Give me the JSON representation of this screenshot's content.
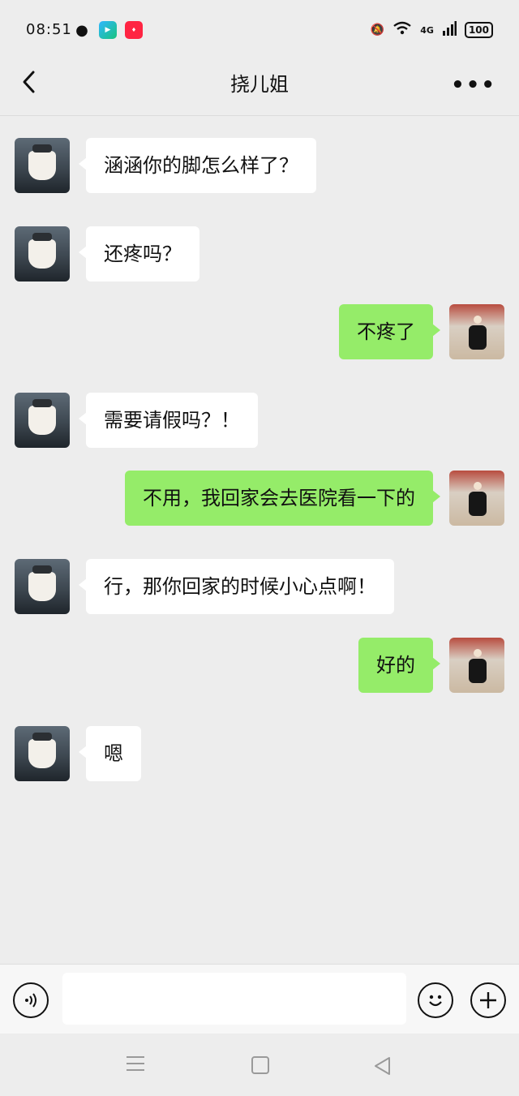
{
  "status_bar": {
    "time": "08:51",
    "network": "4G",
    "battery": "100",
    "icons": [
      "wechat-icon",
      "video-app-icon",
      "xiaohongshu-icon",
      "mute-bell-icon",
      "wifi-icon",
      "signal-icon",
      "battery-icon"
    ]
  },
  "header": {
    "title": "挠儿姐",
    "back_icon": "chevron-left-icon",
    "more_label": "•••"
  },
  "messages": [
    {
      "side": "left",
      "text": "涵涵你的脚怎么样了？"
    },
    {
      "side": "left",
      "text": "还疼吗？"
    },
    {
      "side": "right",
      "text": "不疼了"
    },
    {
      "side": "left",
      "text": "需要请假吗？！"
    },
    {
      "side": "right",
      "text": "不用，我回家会去医院看一下的"
    },
    {
      "side": "left",
      "text": "行，那你回家的时候小心点啊！"
    },
    {
      "side": "right",
      "text": "好的"
    },
    {
      "side": "left",
      "text": "嗯"
    }
  ],
  "input_bar": {
    "voice_icon": "voice-icon",
    "placeholder": "",
    "emoji_icon": "emoji-icon",
    "plus_icon": "plus-icon",
    "emoji_glyph": "☺",
    "plus_glyph": "+"
  },
  "colors": {
    "background": "#ededed",
    "bubble_self": "#95ec69",
    "bubble_other": "#ffffff"
  }
}
